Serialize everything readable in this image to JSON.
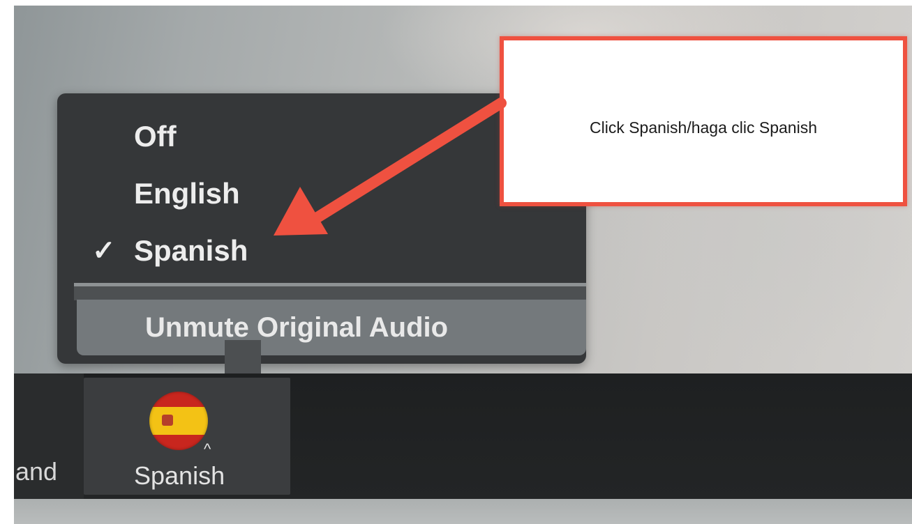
{
  "audio_menu": {
    "items": [
      {
        "label": "Off",
        "selected": false
      },
      {
        "label": "English",
        "selected": false
      },
      {
        "label": "Spanish",
        "selected": true
      }
    ],
    "check_glyph": "✓",
    "unmute_label": "Unmute Original Audio"
  },
  "toolbar": {
    "partial_item_label": "and",
    "language_button": {
      "label": "Spanish",
      "icon": "spain-flag-icon",
      "caret_glyph": "^"
    }
  },
  "callout": {
    "text": "Click Spanish/haga clic Spanish",
    "border_color": "#ef5140"
  },
  "annotation_arrow": {
    "color": "#ef5140",
    "points_to": "Spanish"
  }
}
